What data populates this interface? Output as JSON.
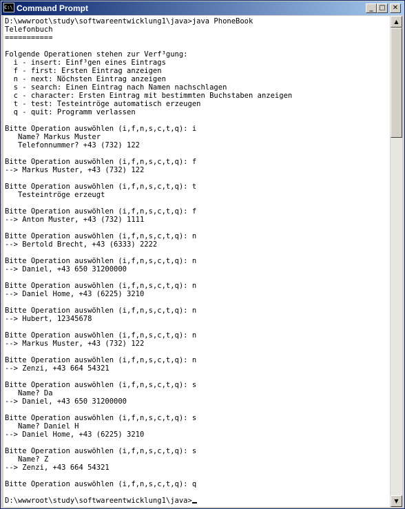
{
  "window": {
    "title": "Command Prompt",
    "icon_text": "C:\\"
  },
  "controls": {
    "minimize_icon": "minimize-icon",
    "maximize_icon": "maximize-icon",
    "close_icon": "close-icon"
  },
  "console": {
    "lines": [
      "D:\\wwwroot\\study\\softwareentwicklung1\\java>java PhoneBook",
      "Telefonbuch",
      "===========",
      "",
      "Folgende Operationen stehen zur Verf³gung:",
      "  i - insert: Einf³gen eines Eintrags",
      "  f - first: Ersten Eintrag anzeigen",
      "  n - next: Nöchsten Eintrag anzeigen",
      "  s - search: Einen Eintrag nach Namen nachschlagen",
      "  c - character: Ersten Eintrag mit bestimmten Buchstaben anzeigen",
      "  t - test: Testeintröge automatisch erzeugen",
      "  q - quit: Programm verlassen",
      "",
      "Bitte Operation auswöhlen (i,f,n,s,c,t,q): i",
      "   Name? Markus Muster",
      "   Telefonnummer? +43 (732) 122",
      "",
      "Bitte Operation auswöhlen (i,f,n,s,c,t,q): f",
      "--> Markus Muster, +43 (732) 122",
      "",
      "Bitte Operation auswöhlen (i,f,n,s,c,t,q): t",
      "   Testeintröge erzeugt",
      "",
      "Bitte Operation auswöhlen (i,f,n,s,c,t,q): f",
      "--> Anton Muster, +43 (732) 1111",
      "",
      "Bitte Operation auswöhlen (i,f,n,s,c,t,q): n",
      "--> Bertold Brecht, +43 (6333) 2222",
      "",
      "Bitte Operation auswöhlen (i,f,n,s,c,t,q): n",
      "--> Daniel, +43 650 31200000",
      "",
      "Bitte Operation auswöhlen (i,f,n,s,c,t,q): n",
      "--> Daniel Home, +43 (6225) 3210",
      "",
      "Bitte Operation auswöhlen (i,f,n,s,c,t,q): n",
      "--> Hubert, 12345678",
      "",
      "Bitte Operation auswöhlen (i,f,n,s,c,t,q): n",
      "--> Markus Muster, +43 (732) 122",
      "",
      "Bitte Operation auswöhlen (i,f,n,s,c,t,q): n",
      "--> Zenzi, +43 664 54321",
      "",
      "Bitte Operation auswöhlen (i,f,n,s,c,t,q): s",
      "   Name? Da",
      "--> Daniel, +43 650 31200000",
      "",
      "Bitte Operation auswöhlen (i,f,n,s,c,t,q): s",
      "   Name? Daniel H",
      "--> Daniel Home, +43 (6225) 3210",
      "",
      "Bitte Operation auswöhlen (i,f,n,s,c,t,q): s",
      "   Name? Z",
      "--> Zenzi, +43 664 54321",
      "",
      "Bitte Operation auswöhlen (i,f,n,s,c,t,q): q",
      ""
    ],
    "prompt": "D:\\wwwroot\\study\\softwareentwicklung1\\java>"
  },
  "scrollbar": {
    "up_icon": "scroll-up-arrow-icon",
    "down_icon": "scroll-down-arrow-icon"
  }
}
